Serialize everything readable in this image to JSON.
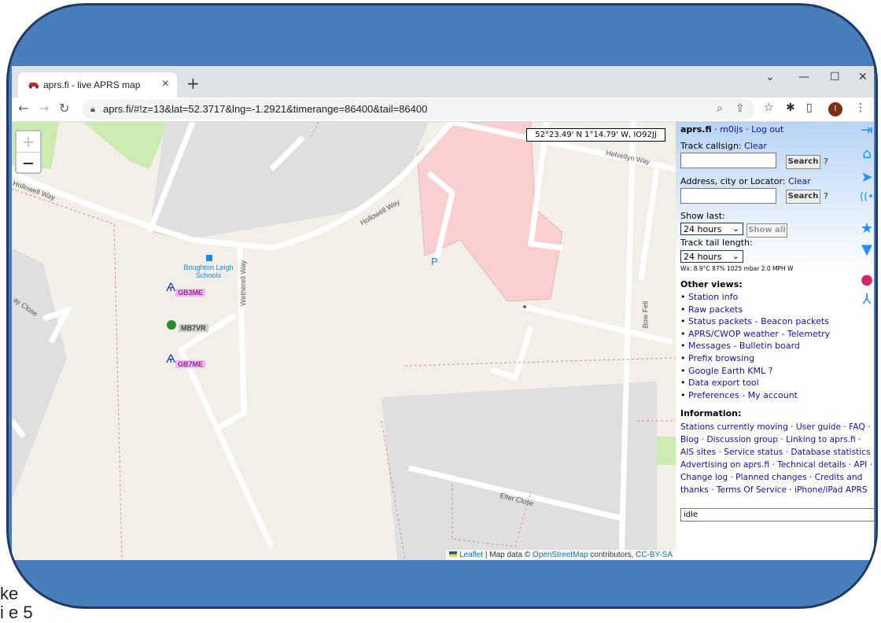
{
  "background": {
    "line1": "ke",
    "line2": "i e 5"
  },
  "browser": {
    "tab_title": "aprs.fi - live APRS map",
    "url": "aprs.fi/#!z=13&lat=52.3717&lng=-1.2921&timerange=86400&tail=86400",
    "profile_initial": "I"
  },
  "map": {
    "coordinate_readout": "52°23.49' N 1°14.79' W, IO92JJ",
    "streets": [
      "Hollowell Way",
      "Hollowell Way",
      "Helvellyn Way",
      "Wetherell Way",
      "Bow Fell",
      "Elter Close",
      "ay Close"
    ],
    "poi": "Boughton Leigh Schools",
    "parking": "P",
    "stations": [
      {
        "callsign": "GB3ME",
        "color": "#f7b6f7"
      },
      {
        "callsign": "MB7VR",
        "color": "#cccccc"
      },
      {
        "callsign": "GB7ME",
        "color": "#f7b6f7"
      }
    ],
    "attribution": {
      "leaflet": "Leaflet",
      "sep": " | Map data © ",
      "osm": "OpenStreetMap",
      "contrib": " contributors, ",
      "license": "CC-BY-SA"
    }
  },
  "sidebar": {
    "site": "aprs.fi",
    "user": "m0ijs",
    "logout": "Log out",
    "track_label": "Track callsign:",
    "clear": "Clear",
    "search": "Search",
    "help": "?",
    "address_label": "Address, city or Locator:",
    "show_last_label": "Show last:",
    "show_last_value": "24 hours",
    "show_all": "Show all",
    "tail_label": "Track tail length:",
    "tail_value": "24 hours",
    "wx": "Wx: 8.9°C 87% 1025 mbar 2.0 MPH W",
    "other_views_title": "Other views:",
    "other_views": [
      "Station info",
      "Raw packets",
      "Status packets - Beacon packets",
      "APRS/CWOP weather - Telemetry",
      "Messages - Bulletin board",
      "Prefix browsing",
      "Google Earth KML ?",
      "Data export tool",
      "Preferences - My account"
    ],
    "information_title": "Information:",
    "information_lines": [
      "Stations currently moving · User guide · FAQ ·",
      "Blog · Discussion group · Linking to aprs.fi ·",
      "AIS sites · Service status · Database statistics ·",
      "Advertising on aprs.fi · Technical details · API ·",
      "Change log · Planned changes · Credits and",
      "thanks · Terms Of Service · iPhone/iPad APRS"
    ],
    "status": "idle"
  },
  "rail_icons": [
    "sign-in-icon",
    "home-icon",
    "locate-icon",
    "radio-icon",
    "star-icon",
    "filter-icon",
    "balloon-icon",
    "compass-icon"
  ],
  "colors": {
    "frame": "#4a7dbb",
    "building": "#f9cfcf",
    "accent": "#1e90ff"
  }
}
